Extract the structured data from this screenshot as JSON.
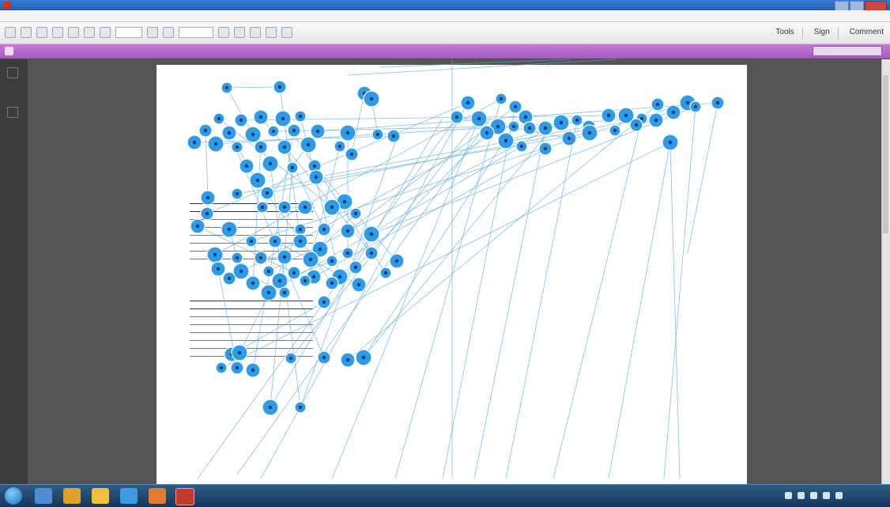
{
  "window": {
    "title": "",
    "accent": "#2a64b8"
  },
  "menubar": {
    "items": [
      "",
      "",
      "",
      ""
    ]
  },
  "toolbar": {
    "page_field": "",
    "zoom_field": "",
    "right_items": [
      "Tools",
      "Sign",
      "Comment"
    ]
  },
  "notice": {
    "text": "",
    "button_label": "",
    "color": "#b06ccc"
  },
  "document": {
    "heading": "",
    "paragraphs": [
      "",
      "",
      "",
      "",
      "",
      "",
      ""
    ],
    "table1": {
      "header": [
        "",
        "",
        "",
        "",
        "",
        ""
      ],
      "rows": [
        [
          "",
          "",
          "",
          "",
          "",
          ""
        ],
        [
          "",
          "",
          "",
          "",
          "",
          ""
        ],
        [
          "",
          "",
          "",
          "",
          "",
          ""
        ],
        [
          "",
          "",
          "",
          "",
          "",
          ""
        ],
        [
          "",
          "",
          "",
          "",
          "",
          ""
        ],
        [
          "",
          "",
          "",
          "",
          "",
          ""
        ]
      ],
      "caption": "",
      "note": ""
    },
    "table2": {
      "header": [
        "",
        "",
        "",
        "",
        "",
        ""
      ],
      "rows": [
        [
          "",
          "",
          "",
          "",
          "",
          ""
        ],
        [
          "",
          "",
          "",
          "",
          "",
          ""
        ],
        [
          "",
          "",
          "",
          "",
          "",
          ""
        ],
        [
          "",
          "",
          "",
          "",
          "",
          ""
        ],
        [
          "",
          "",
          "",
          "",
          "",
          ""
        ],
        [
          "",
          "",
          "",
          "",
          "",
          ""
        ]
      ],
      "caption": "",
      "note": ""
    }
  },
  "gaze_overlay": {
    "point_color": "#2f9be8",
    "line_color": "#5aa9e6",
    "point_labels": []
  },
  "taskbar": {
    "apps": [
      "start-orb",
      "folder-icon",
      "media-player-icon",
      "file-explorer-icon",
      "internet-explorer-icon",
      "firefox-icon",
      "adobe-reader-icon"
    ],
    "clock_time": "",
    "clock_date": ""
  }
}
